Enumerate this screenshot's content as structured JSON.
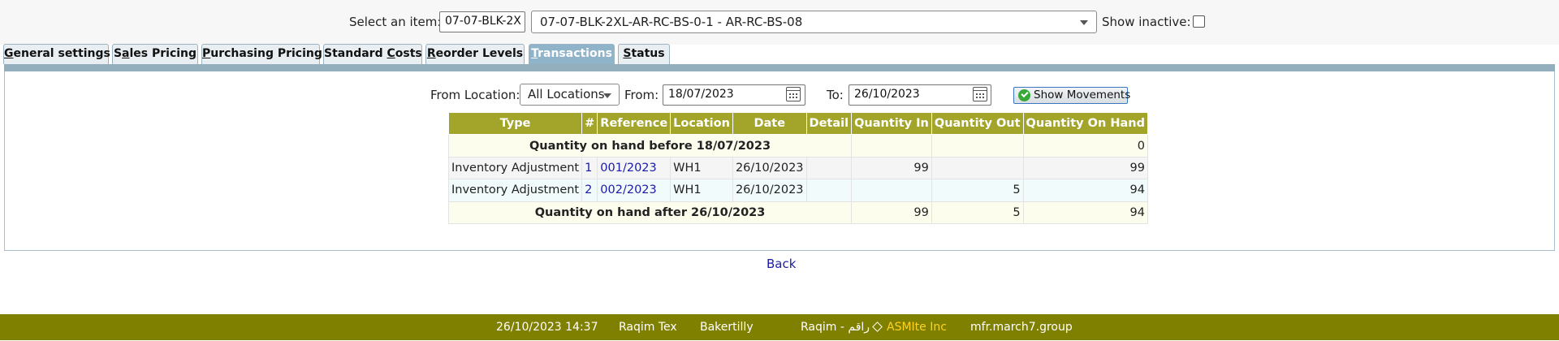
{
  "header": {
    "select_item_label": "Select an item:",
    "item_code_value": "07-07-BLK-2X",
    "item_select_value": "07-07-BLK-2XL-AR-RC-BS-0-1 - AR-RC-BS-08",
    "show_inactive_label": "Show inactive:",
    "show_inactive_checked": false
  },
  "tabs": [
    {
      "pre": "",
      "key": "G",
      "post": "eneral settings",
      "active": false
    },
    {
      "pre": "S",
      "key": "a",
      "post": "les Pricing",
      "active": false
    },
    {
      "pre": "",
      "key": "P",
      "post": "urchasing Pricing",
      "active": false
    },
    {
      "pre": "Standard ",
      "key": "C",
      "post": "osts",
      "active": false
    },
    {
      "pre": "",
      "key": "R",
      "post": "eorder Levels",
      "active": false
    },
    {
      "pre": "",
      "key": "T",
      "post": "ransactions",
      "active": true
    },
    {
      "pre": "",
      "key": "S",
      "post": "tatus",
      "active": false
    }
  ],
  "filters": {
    "from_location_label": "From Location:",
    "location_value": "All Locations",
    "from_label": "From:",
    "from_date": "18/07/2023",
    "to_label": "To:",
    "to_date": "26/10/2023",
    "show_movements_label": "Show Movements"
  },
  "table": {
    "headers": [
      "Type",
      "#",
      "Reference",
      "Location",
      "Date",
      "Detail",
      "Quantity In",
      "Quantity Out",
      "Quantity On Hand"
    ],
    "before_label": "Quantity on hand before 18/07/2023",
    "before_qty": "0",
    "rows": [
      {
        "type": "Inventory Adjustment",
        "num": "1",
        "reference": "001/2023",
        "location": "WH1",
        "date": "26/10/2023",
        "detail": "",
        "qty_in": "99",
        "qty_out": "",
        "on_hand": "99"
      },
      {
        "type": "Inventory Adjustment",
        "num": "2",
        "reference": "002/2023",
        "location": "WH1",
        "date": "26/10/2023",
        "detail": "",
        "qty_in": "",
        "qty_out": "5",
        "on_hand": "94"
      }
    ],
    "after_label": "Quantity on hand after 26/10/2023",
    "after_in": "99",
    "after_out": "5",
    "after_on_hand": "94"
  },
  "back_label": "Back",
  "footer": {
    "datetime": "26/10/2023 14:37",
    "company": "Raqim Tex",
    "user": "Bakertilly",
    "brand": "Raqim - راقم",
    "partner": "ASMIte Inc",
    "domain": "mfr.march7.group"
  },
  "colors": {
    "table_header": "#a3a52b",
    "footer": "#808000",
    "active_tab": "#8fb3c8",
    "link": "#1a1aa8",
    "partner_text": "#ffd21f"
  }
}
